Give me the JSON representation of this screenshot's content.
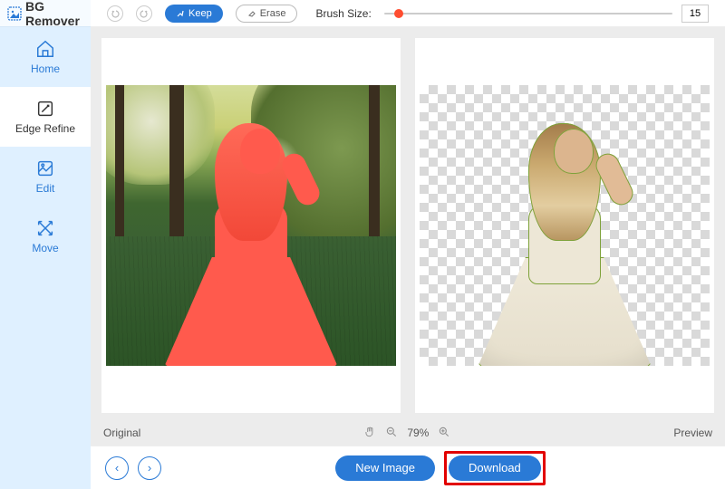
{
  "brand": {
    "name": "BG Remover"
  },
  "sidebar": {
    "items": [
      {
        "label": "Home",
        "icon": "home-icon"
      },
      {
        "label": "Edge Refine",
        "icon": "edge-refine-icon"
      },
      {
        "label": "Edit",
        "icon": "edit-icon"
      },
      {
        "label": "Move",
        "icon": "move-icon"
      }
    ]
  },
  "toolbar": {
    "keep_label": "Keep",
    "erase_label": "Erase",
    "brush_label": "Brush Size:",
    "brush_value": "15"
  },
  "status": {
    "left_label": "Original",
    "zoom": "79%",
    "right_label": "Preview"
  },
  "actions": {
    "new_image": "New Image",
    "download": "Download"
  },
  "colors": {
    "accent": "#2a7ad6",
    "mask": "#ff5a4d",
    "highlight": "#e20000"
  }
}
